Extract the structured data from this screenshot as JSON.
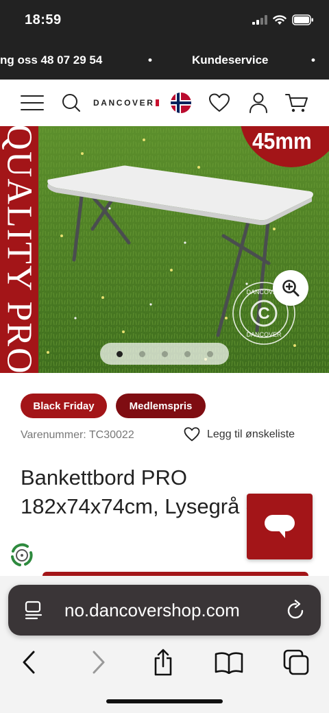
{
  "status_bar": {
    "time": "18:59"
  },
  "marquee": {
    "left_text": "ng oss 48 07 29 54",
    "separator": "•",
    "right_text": "Kundeservice"
  },
  "header": {
    "logo": "DANCOVER"
  },
  "hero": {
    "side_text": "QUALITY PRO",
    "badge_text": "45mm",
    "watermark_text": "DANCOVER",
    "slides": 5,
    "active_slide": 1
  },
  "tags": {
    "black_friday": "Black Friday",
    "member_price": "Medlemspris"
  },
  "product": {
    "sku": "Varenummer: TC30022",
    "wishlist": "Legg til ønskeliste",
    "title": "Bankettbord PRO 182x74x74cm, Lysegrå (1 stk.)"
  },
  "browser": {
    "url": "no.dancovershop.com"
  },
  "colors": {
    "brand_red": "#a31518",
    "dark_red": "#7f0d12",
    "dark_bar": "#222222"
  }
}
